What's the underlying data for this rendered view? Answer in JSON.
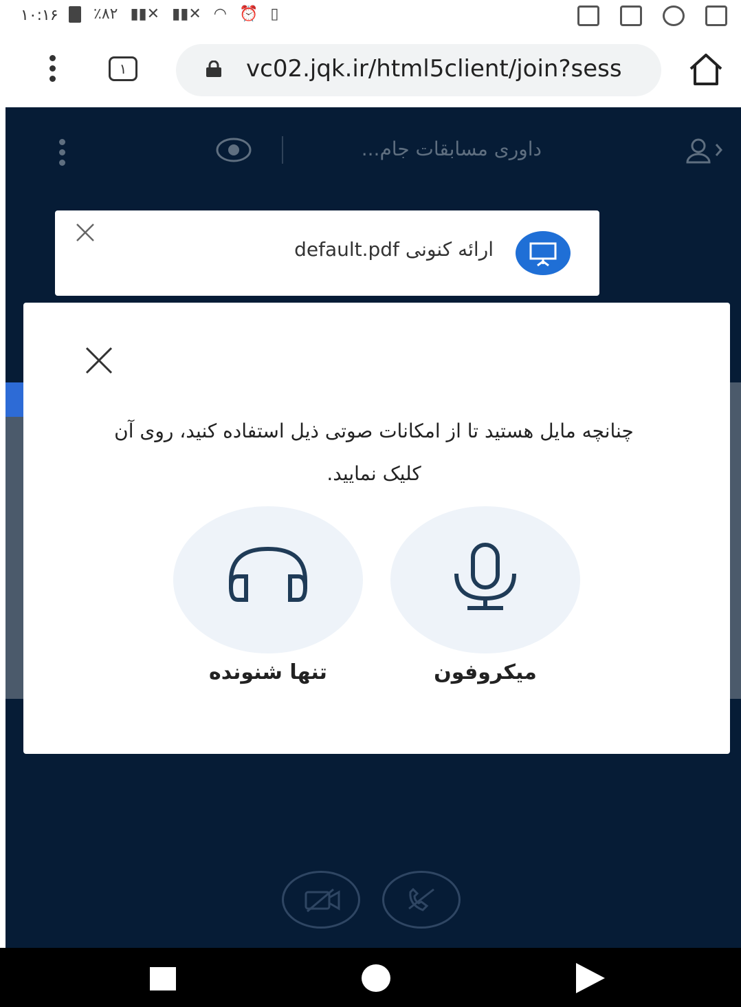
{
  "status_bar": {
    "time": "۱۰:۱۶",
    "battery": "٪۸۲"
  },
  "browser": {
    "tab_count": "۱",
    "url": "vc02.jqk.ir/html5client/join?sess"
  },
  "app_header": {
    "meeting_title": "داوری مسابقات جام..."
  },
  "presentation_toast": {
    "label": "ارائه کنونی",
    "file": "default.pdf"
  },
  "audio_modal": {
    "message": "چنانچه مایل هستید تا از امکانات صوتی ذیل استفاده کنید، روی آن کلیک نمایید.",
    "options": [
      {
        "label": "میکروفون",
        "icon": "microphone-icon"
      },
      {
        "label": "تنها شنونده",
        "icon": "headphones-icon"
      }
    ]
  },
  "colors": {
    "app_background": "#061c36",
    "accent_blue": "#1f6fd6",
    "option_bg": "#eef3f9",
    "icon_color": "#1f3b57"
  }
}
